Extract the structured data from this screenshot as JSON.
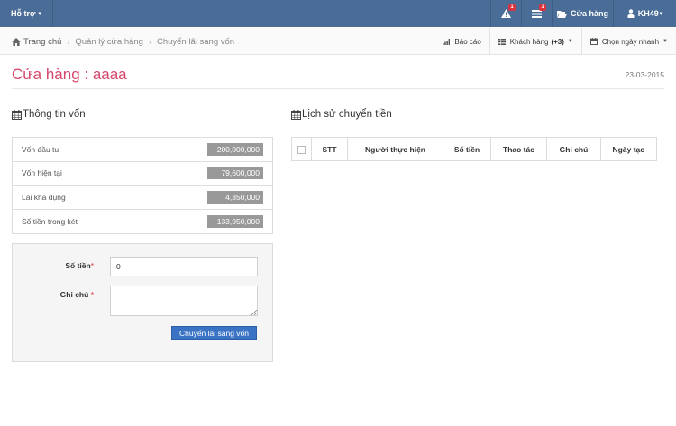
{
  "navbar": {
    "support_label": "Hỗ trợ",
    "alert_badge": "1",
    "message_badge": "1",
    "store_label": "Cửa hàng",
    "user_label": "KH49"
  },
  "breadcrumb": {
    "home": "Trang chủ",
    "items": [
      "Quản lý cửa hàng",
      "Chuyển lãi sang vốn"
    ]
  },
  "tools": {
    "report": "Báo cáo",
    "customer": "Khách hàng",
    "customer_count": "(+3)",
    "date_picker": "Chọn ngày nhanh"
  },
  "page": {
    "title": "Cửa hàng : aaaa",
    "date": "23-03-2015"
  },
  "capital_section": {
    "title": "Thông tin vốn",
    "rows": [
      {
        "label": "Vốn đầu tư",
        "value": "200,000,000"
      },
      {
        "label": "Vốn hiện tại",
        "value": "79,600,000"
      },
      {
        "label": "Lãi khả dụng",
        "value": "4,350,000"
      },
      {
        "label": "Số tiền trong két",
        "value": "133,950,000"
      }
    ]
  },
  "form": {
    "amount_label": "Số tiền",
    "amount_value": "0",
    "note_label": "Ghi chú",
    "note_value": "",
    "required_mark": "*",
    "submit_label": "Chuyển lãi sang vốn"
  },
  "history_section": {
    "title": "Lịch sử chuyển tiền",
    "columns": [
      "STT",
      "Người thực hiện",
      "Số tiền",
      "Thao tác",
      "Ghi chú",
      "Ngày tạo"
    ]
  },
  "icons": {
    "alert": "warning-icon",
    "message": "tasks-icon",
    "store": "folder-open-icon",
    "user": "user-icon",
    "home": "home-icon",
    "report": "bar-chart-icon",
    "customer": "list-icon",
    "calendar": "calendar-icon"
  },
  "colors": {
    "navbar": "#4a6d97",
    "title": "#d6466a",
    "badge": "#d9333f",
    "value_badge": "#999999",
    "button": "#3a72c4"
  }
}
